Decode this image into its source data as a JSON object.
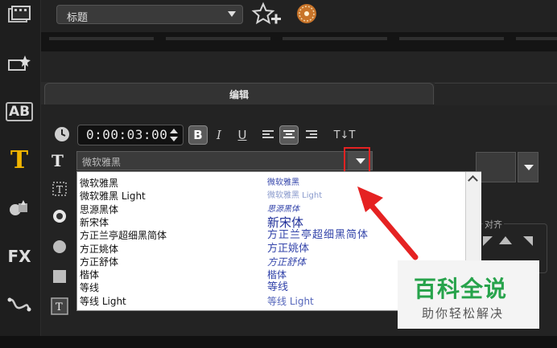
{
  "top_bar": {
    "title_select_value": "标题",
    "favorite_icon": "star-plus-icon",
    "orb_icon": "orb-icon"
  },
  "left_rail": {
    "items": [
      {
        "icon": "media-film-icon"
      },
      {
        "icon": "instant-project-icon"
      },
      {
        "icon": "transition-ab-icon",
        "label": "AB"
      },
      {
        "icon": "title-t-icon",
        "label": "T",
        "active": true
      },
      {
        "icon": "graphics-icon"
      },
      {
        "icon": "filter-fx-icon",
        "label": "FX"
      },
      {
        "icon": "path-motion-icon"
      }
    ]
  },
  "panel": {
    "tab_label": "编辑",
    "timecode": "0:00:03:00",
    "bold_label": "B",
    "italic_label": "I",
    "underline_label": "U",
    "text_direction_label": "T↓T",
    "font_combo_value": "微软雅黑",
    "font_list": [
      {
        "name": "微软雅黑",
        "preview": "微软雅黑"
      },
      {
        "name": "微软雅黑 Light",
        "preview": "微软雅黑 Light"
      },
      {
        "name": "思源黑体",
        "preview": "思源黑体"
      },
      {
        "name": "新宋体",
        "preview": "新宋体"
      },
      {
        "name": "方正兰亭超细黑简体",
        "preview": "方正兰亭超细黑简体"
      },
      {
        "name": "方正姚体",
        "preview": "方正姚体"
      },
      {
        "name": "方正舒体",
        "preview": "方正舒体"
      },
      {
        "name": "楷体",
        "preview": "楷体"
      },
      {
        "name": "等线",
        "preview": "等线"
      },
      {
        "name": "等线 Light",
        "preview": "等线 Light"
      }
    ],
    "align_group_label": "对齐"
  },
  "watermark": {
    "title": "百科全说",
    "subtitle": "助你轻松解决"
  },
  "colors": {
    "accent_title_icon": "#f0b400",
    "highlight_red": "#e52222",
    "watermark_green": "#27a34b"
  }
}
